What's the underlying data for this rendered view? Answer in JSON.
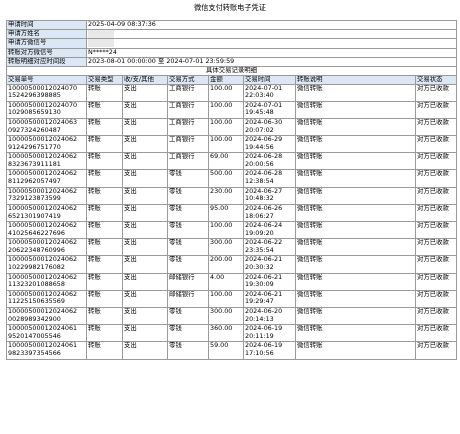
{
  "document": {
    "title": "微信支付转账电子凭证"
  },
  "info": [
    {
      "label": "申请时间",
      "value": "2025-04-09 08:37:36"
    },
    {
      "label": "申请方姓名",
      "value": ""
    },
    {
      "label": "申请方微信号",
      "value": ""
    },
    {
      "label": "转账对方微信号",
      "value": "N*****24"
    },
    {
      "label": "转账明细对应时间段",
      "value": "2023-08-01 00:00:00 至 2024-07-01 23:59:59"
    }
  ],
  "section_title": "具体交易记录明细",
  "columns": [
    "交易单号",
    "交易类型",
    "收/支/其他",
    "交易方式",
    "金额",
    "交易时间",
    "转账说明",
    "交易状态"
  ],
  "rows": [
    {
      "id1": "10000500012024070",
      "id2": "1524296398885",
      "type": "转账",
      "dir": "支出",
      "method": "工商银行",
      "amount": "100.00",
      "date": "2024-07-01",
      "time": "22:03:40",
      "note": "微信转账",
      "status": "对方已收款"
    },
    {
      "id1": "10000500012024070",
      "id2": "1029085659130",
      "type": "转账",
      "dir": "支出",
      "method": "工商银行",
      "amount": "100.00",
      "date": "2024-07-01",
      "time": "19:45:48",
      "note": "微信转账",
      "status": "对方已收款"
    },
    {
      "id1": "10000500012024063",
      "id2": "0927324260487",
      "type": "转账",
      "dir": "支出",
      "method": "工商银行",
      "amount": "100.00",
      "date": "2024-06-30",
      "time": "20:07:02",
      "note": "微信转账",
      "status": "对方已收款"
    },
    {
      "id1": "10000500012024062",
      "id2": "9124296751770",
      "type": "转账",
      "dir": "支出",
      "method": "工商银行",
      "amount": "100.00",
      "date": "2024-06-29",
      "time": "19:44:56",
      "note": "微信转账",
      "status": "对方已收款"
    },
    {
      "id1": "10000500012024062",
      "id2": "8323673911181",
      "type": "转账",
      "dir": "支出",
      "method": "工商银行",
      "amount": "69.00",
      "date": "2024-06-28",
      "time": "20:00:56",
      "note": "微信转账",
      "status": "对方已收款"
    },
    {
      "id1": "10000500012024062",
      "id2": "8112962057497",
      "type": "转账",
      "dir": "支出",
      "method": "零钱",
      "amount": "500.00",
      "date": "2024-06-28",
      "time": "12:38:54",
      "note": "微信转账",
      "status": "对方已收款"
    },
    {
      "id1": "10000500012024062",
      "id2": "7329123873599",
      "type": "转账",
      "dir": "支出",
      "method": "零钱",
      "amount": "230.00",
      "date": "2024-06-27",
      "time": "10:48:32",
      "note": "微信转账",
      "status": "对方已收款"
    },
    {
      "id1": "10000500012024062",
      "id2": "6521301907419",
      "type": "转账",
      "dir": "支出",
      "method": "零钱",
      "amount": "95.00",
      "date": "2024-06-26",
      "time": "18:06:27",
      "note": "微信转账",
      "status": "对方已收款"
    },
    {
      "id1": "10000500012024062",
      "id2": "41025646227696",
      "type": "转账",
      "dir": "支出",
      "method": "零钱",
      "amount": "100.00",
      "date": "2024-06-24",
      "time": "19:09:20",
      "note": "微信转账",
      "status": "对方已收款"
    },
    {
      "id1": "10000500012024062",
      "id2": "20622348760996",
      "type": "转账",
      "dir": "支出",
      "method": "零钱",
      "amount": "300.00",
      "date": "2024-06-22",
      "time": "23:35:54",
      "note": "微信转账",
      "status": "对方已收款"
    },
    {
      "id1": "10000500012024062",
      "id2": "10229982176082",
      "type": "转账",
      "dir": "支出",
      "method": "零钱",
      "amount": "200.00",
      "date": "2024-06-21",
      "time": "20:30:32",
      "note": "微信转账",
      "status": "对方已收款"
    },
    {
      "id1": "10000500012024062",
      "id2": "11323201088658",
      "type": "转账",
      "dir": "支出",
      "method": "邮储银行",
      "amount": "4.00",
      "date": "2024-06-21",
      "time": "19:30:09",
      "note": "微信转账",
      "status": "对方已收款"
    },
    {
      "id1": "10000500012024062",
      "id2": "11225150635569",
      "type": "转账",
      "dir": "支出",
      "method": "邮储银行",
      "amount": "100.00",
      "date": "2024-06-21",
      "time": "19:29:47",
      "note": "微信转账",
      "status": "对方已收款"
    },
    {
      "id1": "10000500012024062",
      "id2": "0028989342900",
      "type": "转账",
      "dir": "支出",
      "method": "零钱",
      "amount": "300.00",
      "date": "2024-06-20",
      "time": "20:14:13",
      "note": "微信转账",
      "status": "对方已收款"
    },
    {
      "id1": "10000500012024061",
      "id2": "9520147005546",
      "type": "转账",
      "dir": "支出",
      "method": "零钱",
      "amount": "360.00",
      "date": "2024-06-19",
      "time": "20:11:19",
      "note": "微信转账",
      "status": "对方已收款"
    },
    {
      "id1": "10000500012024061",
      "id2": "9823397354566",
      "type": "转账",
      "dir": "支出",
      "method": "零钱",
      "amount": "59.00",
      "date": "2024-06-19",
      "time": "17:10:56",
      "note": "微信转账",
      "status": "对方已收款"
    }
  ]
}
